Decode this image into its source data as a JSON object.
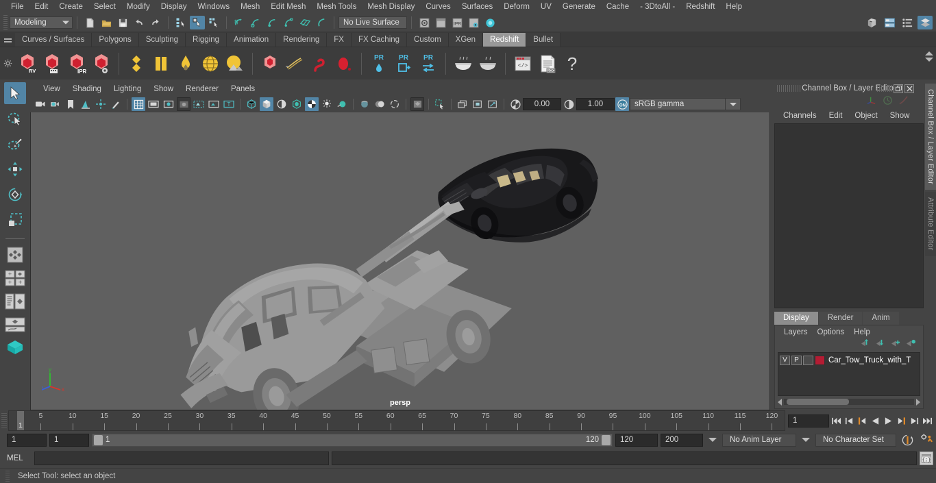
{
  "menubar": {
    "items": [
      "File",
      "Edit",
      "Create",
      "Select",
      "Modify",
      "Display",
      "Windows",
      "Mesh",
      "Edit Mesh",
      "Mesh Tools",
      "Mesh Display",
      "Curves",
      "Surfaces",
      "Deform",
      "UV",
      "Generate",
      "Cache",
      "- 3DtoAll -",
      "Redshift",
      "Help"
    ]
  },
  "statusline": {
    "mode": "Modeling",
    "live_surface": "No Live Surface",
    "icons": [
      "new-scene-icon",
      "open-scene-icon",
      "save-scene-icon",
      "undo-icon",
      "redo-icon",
      "select-hierarchy-icon",
      "select-object-icon",
      "select-component-icon",
      "snap-grid-icon",
      "snap-curve-icon",
      "snap-point-icon",
      "snap-projected-icon",
      "snap-view-plane-icon",
      "make-live-icon",
      "render-view-icon",
      "render-current-frame-icon",
      "ipr-render-icon",
      "render-settings-icon",
      "hypershade-icon"
    ],
    "right_icons": [
      "show-hide-modeling-toolkit-icon",
      "show-hide-attribute-editor-icon",
      "show-hide-tool-settings-icon",
      "show-hide-channel-box-icon"
    ]
  },
  "shelf": {
    "tabs": [
      "Curves / Surfaces",
      "Polygons",
      "Sculpting",
      "Rigging",
      "Animation",
      "Rendering",
      "FX",
      "FX Caching",
      "Custom",
      "XGen",
      "Redshift",
      "Bullet"
    ],
    "active_tab": "Redshift",
    "button_labels": [
      "RV",
      "IPR",
      "PR",
      "PR",
      "PR",
      ".LOG"
    ],
    "icons": [
      "redshift-render-view-icon",
      "redshift-render-sequence-icon",
      "redshift-ipr-icon",
      "redshift-render-settings-icon",
      "redshift-material-icon",
      "redshift-material-blend-icon",
      "redshift-light-dome-icon",
      "redshift-sphere-light-icon",
      "redshift-area-light-icon",
      "redshift-proxy-icon",
      "redshift-hair-icon",
      "redshift-volume-icon",
      "redshift-sprite-icon",
      "redshift-pr-point-icon",
      "redshift-pr-export-icon",
      "redshift-pr-transfer-icon",
      "redshift-bake-icon",
      "redshift-bake-set-icon",
      "redshift-script-icon",
      "redshift-log-icon",
      "redshift-help-icon"
    ]
  },
  "toolbox": {
    "items": [
      "select-tool",
      "lasso-select-tool",
      "paint-select-tool",
      "move-tool",
      "rotate-tool",
      "scale-tool",
      "last-tool-used",
      "single-pane-layout",
      "four-pane-layout",
      "outliner-persp-layout",
      "persp-graph-layout",
      "hypershade-layout"
    ],
    "active": "select-tool"
  },
  "viewport": {
    "menus": [
      "View",
      "Shading",
      "Lighting",
      "Show",
      "Renderer",
      "Panels"
    ],
    "camera_label": "persp",
    "exposure": "0.00",
    "gamma": "1.00",
    "color_management": "sRGB gamma",
    "toolbar_icons": [
      "camera-icon",
      "camera-attributes-icon",
      "bookmark-icon",
      "image-plane-icon",
      "two-d-pan-zoom-icon",
      "grease-pencil-icon",
      "grid-icon",
      "film-gate-icon",
      "resolution-gate-icon",
      "gate-mask-icon",
      "xray-icon",
      "xray-joints-icon",
      "texture-icon",
      "wireframe-icon",
      "smooth-shade-icon",
      "shaded-wireframe-icon",
      "hardware-texturing-icon",
      "use-all-lights-icon",
      "shadows-icon",
      "screen-space-ao-icon",
      "motion-blur-icon",
      "multisample-icon",
      "isolate-select-icon",
      "xray-active-icon",
      "exposure-icon",
      "gamma-icon",
      "color-management-toggle-icon"
    ],
    "axis": {
      "x": "x",
      "y": "y",
      "z": "z",
      "x_color": "#d9352b",
      "y_color": "#2fbf2f",
      "z_color": "#3b5fd9"
    },
    "bg_color": "#606060"
  },
  "channel_box": {
    "title": "Channel Box / Layer Editor",
    "menus": [
      "Channels",
      "Edit",
      "Object",
      "Show"
    ],
    "window_buttons": [
      "undock-icon",
      "close-icon"
    ],
    "tool_icons": [
      "axis-gizmo-icon",
      "clock-icon",
      "curve-icon"
    ]
  },
  "layer_editor": {
    "tabs": [
      "Display",
      "Render",
      "Anim"
    ],
    "active_tab": "Display",
    "menus": [
      "Layers",
      "Options",
      "Help"
    ],
    "action_icons": [
      "move-layer-up-icon",
      "move-layer-down-icon",
      "new-layer-icon",
      "new-layer-from-selected-icon"
    ],
    "layers": [
      {
        "visible": "V",
        "playback": "P",
        "shading": "",
        "color": "#b41c33",
        "name": "Car_Tow_Truck_with_T"
      }
    ]
  },
  "side_tabs": [
    {
      "label": "Channel Box / Layer Editor",
      "active": true
    },
    {
      "label": "Attribute Editor",
      "active": false
    }
  ],
  "timeline": {
    "ticks": [
      5,
      10,
      15,
      20,
      25,
      30,
      35,
      40,
      45,
      50,
      55,
      60,
      65,
      70,
      75,
      80,
      85,
      90,
      95,
      100,
      105,
      110,
      115,
      120
    ],
    "current_frame_marker": "1",
    "current_frame_field": "1",
    "playback_buttons": [
      "go-to-start-icon",
      "step-back-keyframe-icon",
      "step-back-frame-icon",
      "play-backwards-icon",
      "play-forwards-icon",
      "step-forward-frame-icon",
      "step-forward-keyframe-icon",
      "go-to-end-icon"
    ]
  },
  "range": {
    "anim_start": "1",
    "range_start": "1",
    "slider_start_label": "1",
    "slider_end_label": "120",
    "range_end": "120",
    "anim_end": "200",
    "anim_layer": "No Anim Layer",
    "character_set": "No Character Set",
    "right_icons": [
      "auto-keyframe-icon",
      "animation-preferences-icon"
    ]
  },
  "command_line": {
    "language": "MEL",
    "input_value": "",
    "output_value": "",
    "script_editor_icon": "script-editor-icon"
  },
  "status": {
    "message": "Select Tool: select an object"
  }
}
